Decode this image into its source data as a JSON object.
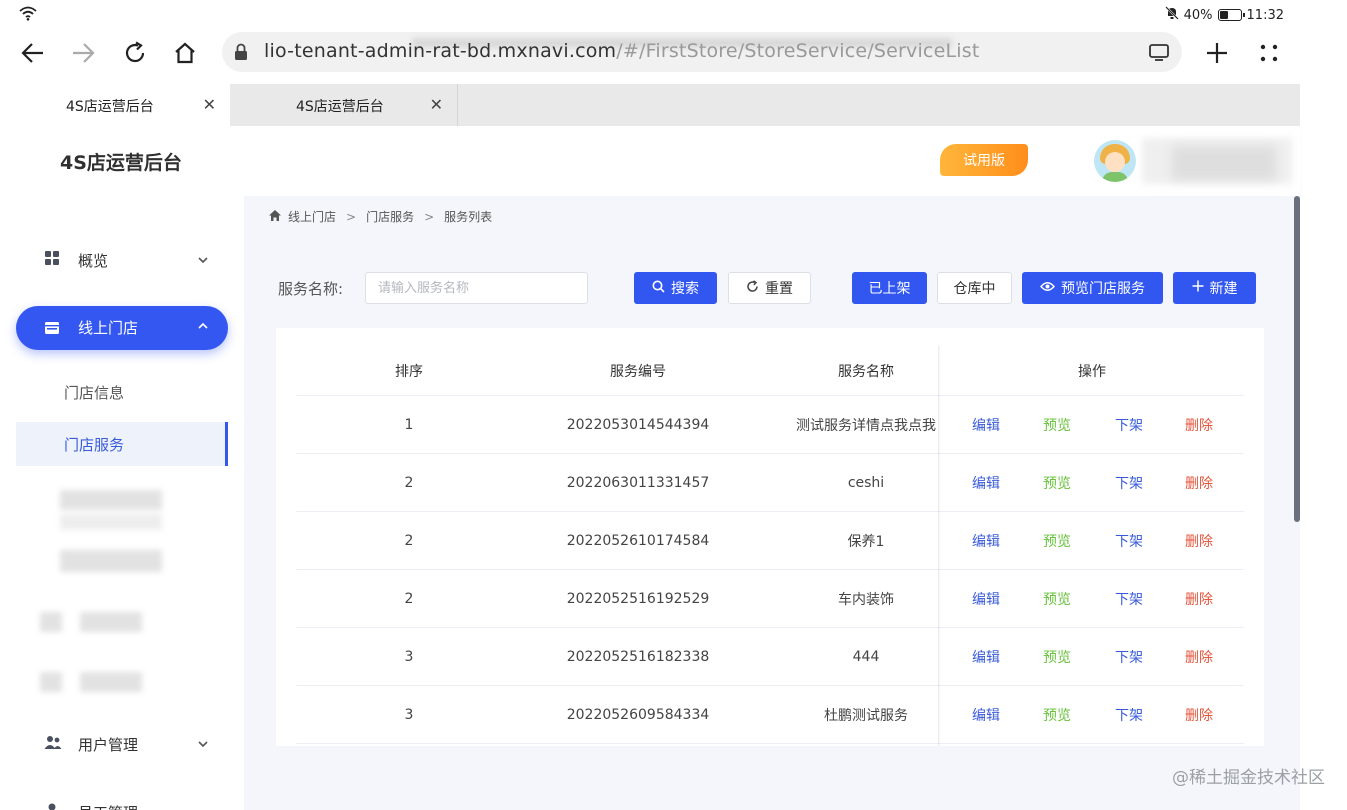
{
  "status_bar": {
    "battery": "40%",
    "time": "11:32",
    "battery_level": 0.4
  },
  "browser": {
    "url_host": "lio-tenant-admin-rat-bd.mxnavi.com",
    "url_path": "/#/FirstStore/StoreService/ServiceList",
    "tabs": [
      {
        "label": "4S店运营后台",
        "close": "✕"
      },
      {
        "label": "4S店运营后台",
        "close": "✕"
      }
    ]
  },
  "header": {
    "title": "4S店运营后台",
    "trial_badge": "试用版"
  },
  "sidebar": {
    "overview": "概览",
    "online_store": "线上门店",
    "store_info": "门店信息",
    "store_service": "门店服务",
    "user_management": "用户管理",
    "staff_management": "员工管理"
  },
  "breadcrumb": [
    "线上门店",
    "门店服务",
    "服务列表"
  ],
  "breadcrumb_sep": ">",
  "search": {
    "label": "服务名称:",
    "placeholder": "请输入服务名称",
    "value": ""
  },
  "buttons": {
    "search": "搜索",
    "reset": "重置",
    "listed": "已上架",
    "warehouse": "仓库中",
    "preview_store": "预览门店服务",
    "create": "新建"
  },
  "table": {
    "columns": [
      "排序",
      "服务编号",
      "服务名称",
      "操作"
    ],
    "actions": {
      "edit": "编辑",
      "preview": "预览",
      "off_shelf": "下架",
      "delete": "删除"
    },
    "rows": [
      {
        "order": "1",
        "code": "2022053014544394",
        "name": "测试服务详情点我点我"
      },
      {
        "order": "2",
        "code": "2022063011331457",
        "name": "ceshi"
      },
      {
        "order": "2",
        "code": "2022052610174584",
        "name": "保养1"
      },
      {
        "order": "2",
        "code": "2022052516192529",
        "name": "车内装饰"
      },
      {
        "order": "3",
        "code": "2022052516182338",
        "name": "444"
      },
      {
        "order": "3",
        "code": "2022052609584334",
        "name": "杜鹏测试服务"
      }
    ]
  },
  "watermark": "@稀土掘金技术社区"
}
